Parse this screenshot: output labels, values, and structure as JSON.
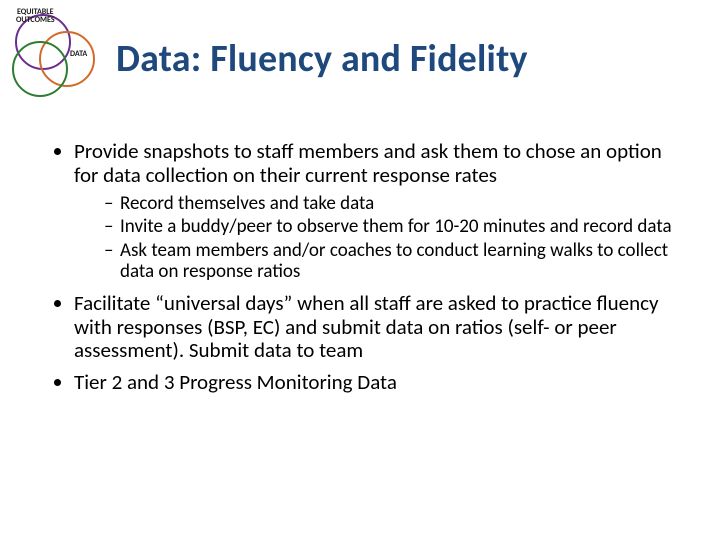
{
  "venn": {
    "label_top": "EQUITABLE\nOUTCOMES",
    "label_right": "DATA"
  },
  "title": "Data:  Fluency and Fidelity",
  "bullets": {
    "b1": "Provide snapshots to staff members and ask them to chose an option for data collection on their current response rates",
    "b1_sub": {
      "s1": "Record themselves and take data",
      "s2": "Invite a buddy/peer to observe them for 10-20 minutes and record data",
      "s3": "Ask team members and/or coaches to conduct learning walks to collect data on response ratios"
    },
    "b2": "Facilitate “universal days” when all staff are asked to practice fluency with responses (BSP, EC) and submit data on ratios (self- or peer assessment). Submit data to team",
    "b3": "Tier 2 and 3 Progress Monitoring Data"
  }
}
